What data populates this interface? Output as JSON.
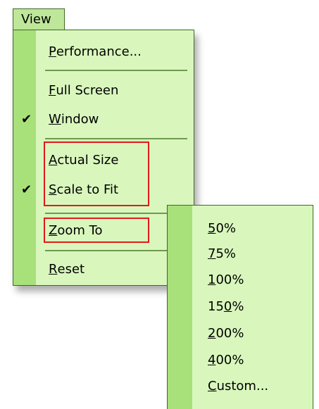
{
  "menu_bar": {
    "view": {
      "label": "View"
    }
  },
  "main_menu": {
    "performance": {
      "ul": "P",
      "rest": "erformance..."
    },
    "full_screen": {
      "ul": "F",
      "rest": "ull Screen"
    },
    "window": {
      "ul": "W",
      "rest": "indow",
      "checked": true
    },
    "actual_size": {
      "ul": "A",
      "rest": "ctual Size"
    },
    "scale_to_fit": {
      "ul": "S",
      "rest": "cale to Fit",
      "checked": true
    },
    "zoom_to": {
      "ul": "Z",
      "rest": "oom To"
    },
    "reset": {
      "ul": "R",
      "rest": "eset"
    },
    "check_glyph": "✔"
  },
  "zoom_submenu": {
    "z50": {
      "ul": "5",
      "rest": "0%"
    },
    "z75": {
      "ul": "7",
      "rest": "5%"
    },
    "z100": {
      "ul": "1",
      "rest": "00%"
    },
    "z150_pre": "15",
    "z150_ul": "0",
    "z150_post": "%",
    "z200": {
      "ul": "2",
      "rest": "00%"
    },
    "z400": {
      "ul": "4",
      "rest": "00%"
    },
    "custom": {
      "ul": "C",
      "rest": "ustom..."
    }
  },
  "colors": {
    "menu_bg": "#d9f7bd",
    "gutter": "#a8e07a",
    "highlight_border": "#e01a1a"
  }
}
